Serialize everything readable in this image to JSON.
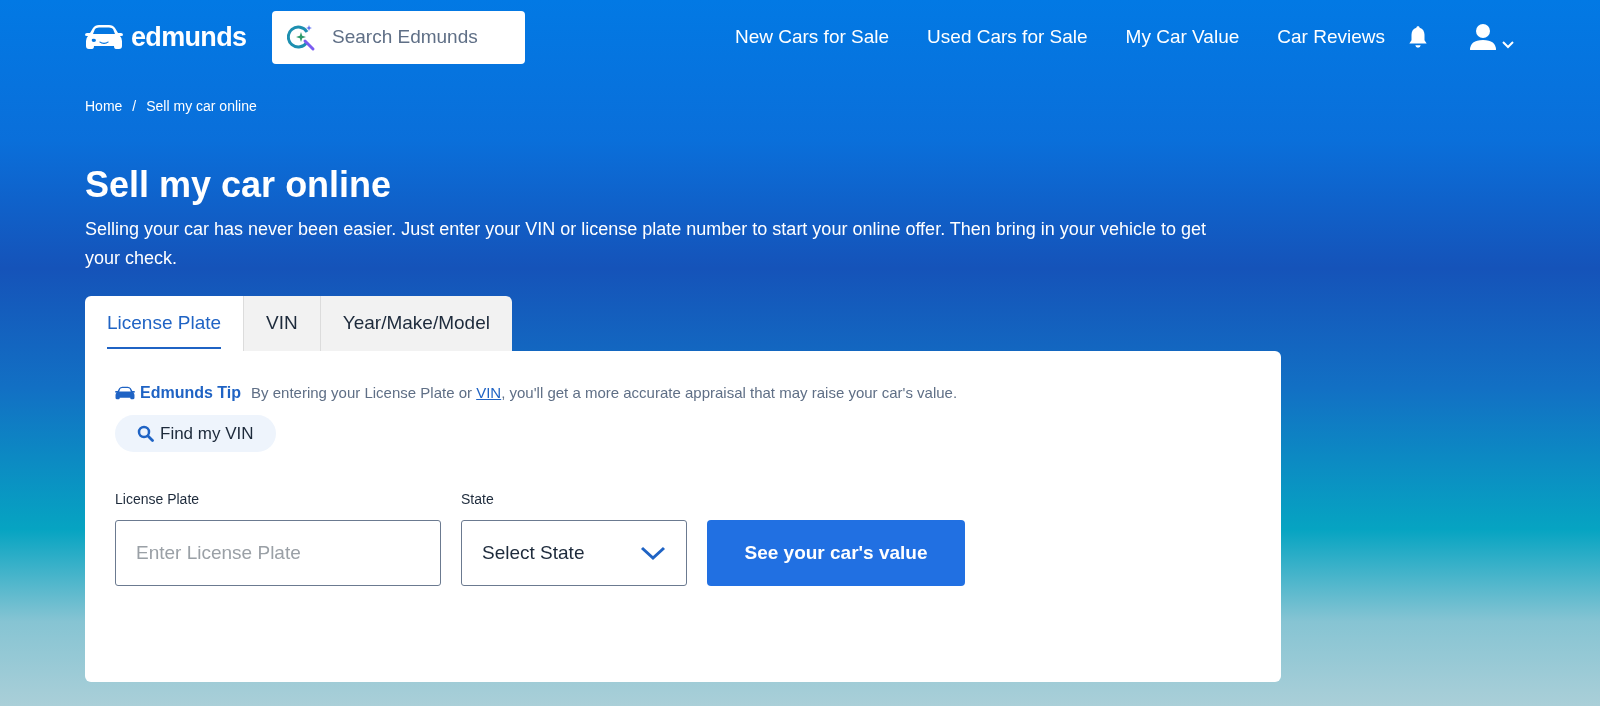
{
  "header": {
    "logo": "edmunds",
    "search": {
      "placeholder": "Search Edmunds"
    },
    "nav": [
      "New Cars for Sale",
      "Used Cars for Sale",
      "My Car Value",
      "Car Reviews"
    ]
  },
  "breadcrumb": {
    "items": [
      "Home",
      "Sell my car online"
    ],
    "separator": "/"
  },
  "title": "Sell my car online",
  "intro": "Selling your car has never been easier. Just enter your VIN or license plate number to start your online offer. Then bring in your vehicle to get your check.",
  "tabs": [
    {
      "label": "License Plate",
      "selected": true
    },
    {
      "label": "VIN",
      "selected": false
    },
    {
      "label": "Year/Make/Model",
      "selected": false
    }
  ],
  "tip": {
    "label": "Edmunds Tip",
    "text_before": "By entering your License Plate or ",
    "link": "VIN",
    "text_after": ", you'll get a more accurate appraisal that may raise your car's value."
  },
  "find_vin_button": "Find my VIN",
  "form": {
    "plate": {
      "label": "License Plate",
      "placeholder": "Enter License Plate"
    },
    "state": {
      "label": "State",
      "value": "Select State"
    },
    "submit": "See your car's value"
  }
}
